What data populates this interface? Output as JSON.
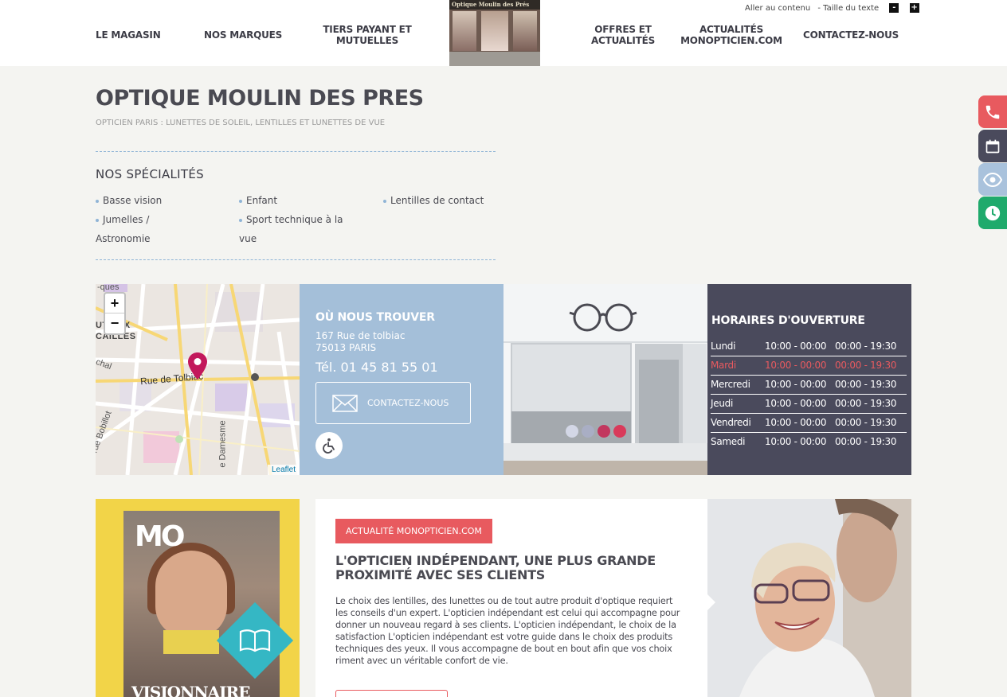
{
  "header": {
    "nav_left": [
      "LE MAGASIN",
      "NOS MARQUES",
      "TIERS PAYANT ET\nMUTUELLES"
    ],
    "nav_right": [
      "OFFRES ET\nACTUALITÉS",
      "ACTUALITÉS\nMONOPTICIEN.COM",
      "CONTACTEZ-NOUS"
    ],
    "shop_sign": "Optique   Moulin des Prés",
    "skip_link": "Aller au contenu",
    "text_size_label": "- Taille du texte",
    "text_minus": "-",
    "text_plus": "+"
  },
  "page": {
    "title": "OPTIQUE MOULIN DES PRES",
    "subtitle": "OPTICIEN PARIS : LUNETTES DE SOLEIL, LENTILLES ET LUNETTES DE VUE"
  },
  "specialties": {
    "title": "NOS SPÉCIALITÉS",
    "col1": [
      "Basse vision",
      "Jumelles /",
      "Astronomie"
    ],
    "col2": [
      "Enfant",
      "Sport technique à la",
      "vue"
    ],
    "col3": [
      "Lentilles de contact"
    ]
  },
  "map": {
    "zoom_in": "+",
    "zoom_out": "−",
    "label_street": "Rue de Tolbiac",
    "label_district": "UT AUX\nCAILLES",
    "label_bobillot": "rue Bobillot",
    "label_damesme": "e Damesme",
    "label_top": "-ques",
    "label_chal": "chal",
    "attribution": "Leaflet"
  },
  "find_us": {
    "title": "OÙ NOUS TROUVER",
    "address_line1": "167 Rue de tolbiac",
    "address_line2": "75013 PARIS",
    "phone": "Tél. 01 45 81 55 01",
    "contact_button": "CONTACTEZ-NOUS"
  },
  "hours": {
    "title": "HORAIRES D'OUVERTURE",
    "rows": [
      {
        "day": "Lundi",
        "am": "10:00 - 00:00",
        "pm": "00:00 - 19:30"
      },
      {
        "day": "Mardi",
        "am": "10:00 - 00:00",
        "pm": "00:00 - 19:30"
      },
      {
        "day": "Mercredi",
        "am": "10:00 - 00:00",
        "pm": "00:00 - 19:30"
      },
      {
        "day": "Jeudi",
        "am": "10:00 - 00:00",
        "pm": "00:00 - 19:30"
      },
      {
        "day": "Vendredi",
        "am": "10:00 - 00:00",
        "pm": "00:00 - 19:30"
      },
      {
        "day": "Samedi",
        "am": "10:00 - 00:00",
        "pm": "00:00 - 19:30"
      }
    ],
    "highlight_color": "#e85a5f"
  },
  "slider": {
    "dot_colors": [
      "#d3d7e6",
      "#a9aec4",
      "#c2375e",
      "#d93a5a"
    ]
  },
  "magazine": {
    "logo": "MO",
    "cover_word": "VISIONNAIRE"
  },
  "article": {
    "tag": "ACTUALITÉ MONOPTICIEN.COM",
    "title": "L'OPTICIEN INDÉPENDANT, UNE PLUS GRANDE PROXIMITÉ AVEC SES CLIENTS",
    "body": "Le choix des lentilles, des lunettes ou de tout autre produit d'optique requiert les conseils d'un expert. L'opticien indépendant est celui qui accompagne pour donner un nouveau regard à ses clients. L'opticien indépendant, le choix de la satisfaction L'opticien indépendant est votre guide dans le choix des produits techniques des yeux. Il vous accompagne de bout en bout afin que vos choix riment avec un véritable confort de vie."
  },
  "colors": {
    "accent_red": "#e85a5f",
    "dark_slate": "#4a4a5c",
    "light_blue": "#a4bfd9",
    "green": "#1faa6c",
    "yellow": "#f2d448"
  }
}
